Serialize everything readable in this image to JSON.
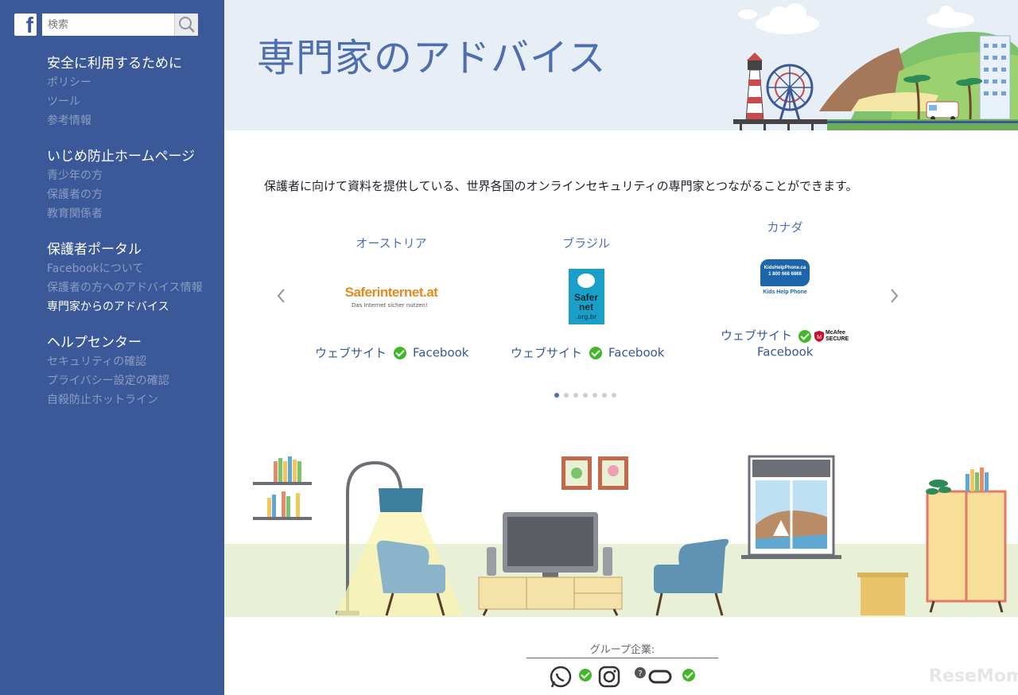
{
  "sidebar": {
    "logo_letter": "f",
    "search_placeholder": "検索",
    "groups": [
      {
        "heading": "安全に利用するために",
        "items": [
          "ポリシー",
          "ツール",
          "参考情報"
        ]
      },
      {
        "heading": "いじめ防止ホームページ",
        "items": [
          "青少年の方",
          "保護者の方",
          "教育関係者"
        ]
      },
      {
        "heading": "保護者ポータル",
        "items": [
          "Facebookについて",
          "保護者の方へのアドバイス情報",
          "専門家からのアドバイス"
        ]
      },
      {
        "heading": "ヘルプセンター",
        "items": [
          "セキュリティの確認",
          "プライバシー設定の確認",
          "自殺防止ホットライン"
        ]
      }
    ],
    "active_item": "専門家からのアドバイス"
  },
  "header": {
    "title": "専門家のアドバイス"
  },
  "intro": "保護者に向けて資料を提供している、世界各国のオンラインセキュリティの専門家とつながることができます。",
  "cards": [
    {
      "country": "オーストリア",
      "logo_text": "Saferinternet.at",
      "logo_sub": "Das Internet sicher nutzen!",
      "website": "ウェブサイト",
      "facebook": "Facebook"
    },
    {
      "country": "ブラジル",
      "logo_text": "Safer net",
      "logo_sub": ".org.br",
      "website": "ウェブサイト",
      "facebook": "Facebook"
    },
    {
      "country": "カナダ",
      "logo_text": "KidsHelpPhone.ca",
      "logo_sub": "1 800 668 6868",
      "logo_caption": "Kids Help Phone",
      "website": "ウェブサイト",
      "facebook": "Facebook",
      "partner": "McAfee SECURE"
    }
  ],
  "carousel": {
    "dot_count": 7,
    "active_dot": 0
  },
  "footer": {
    "label": "グループ企業:"
  },
  "watermark": "ReseMom",
  "colors": {
    "sidebar": "#3b5998",
    "accent": "#4d6eb0",
    "check": "#42b72a"
  }
}
